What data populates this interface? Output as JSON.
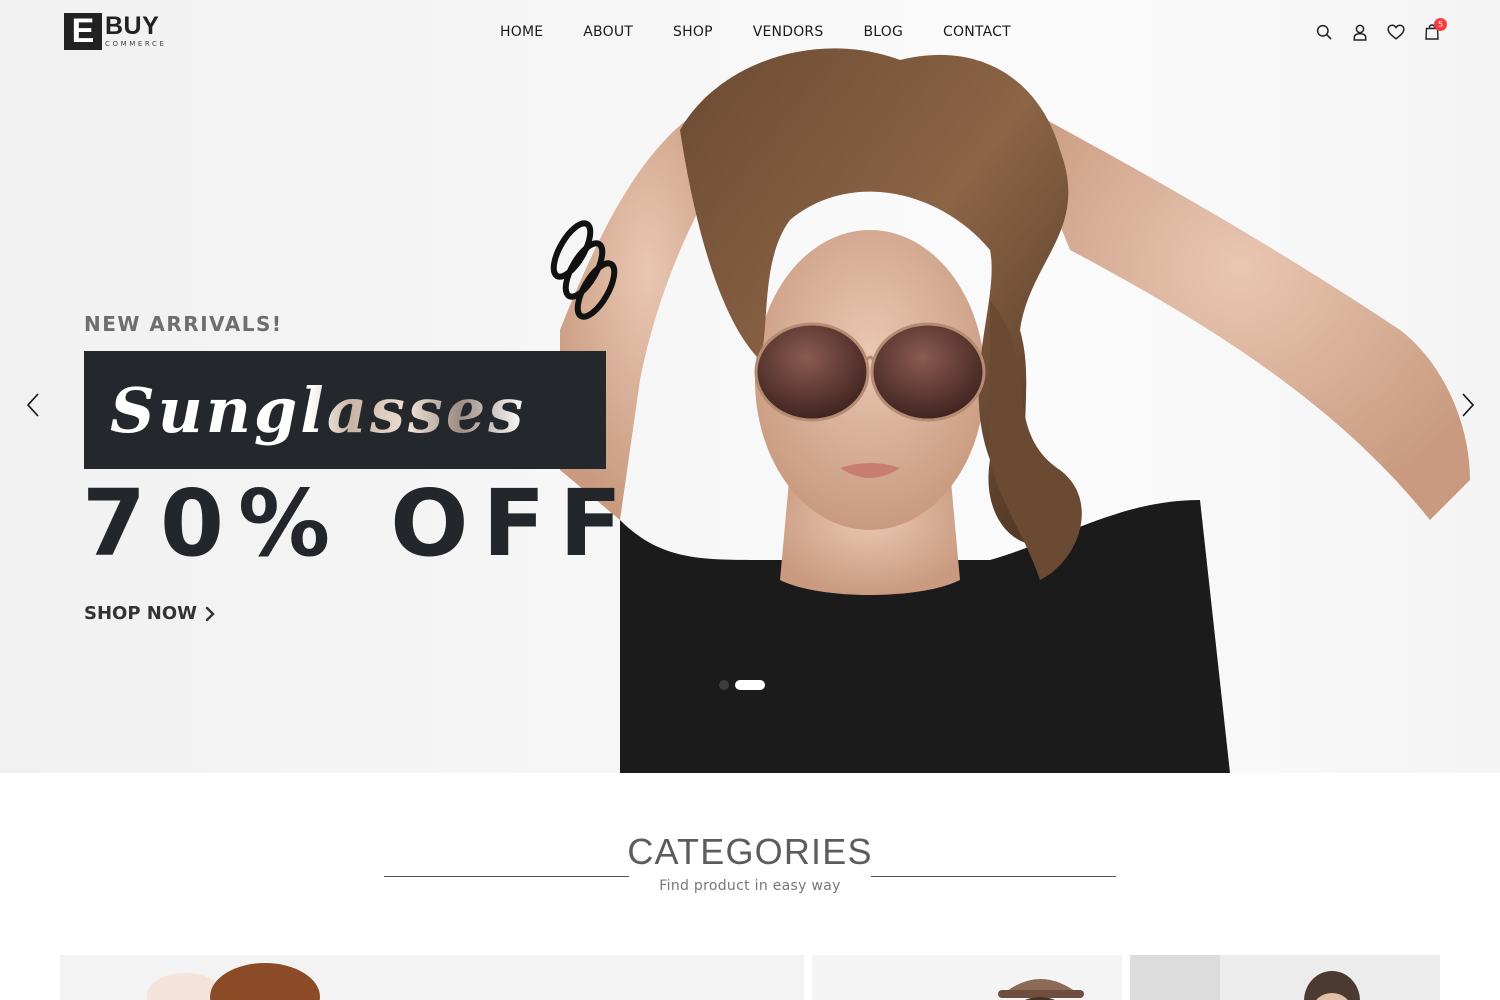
{
  "brand": {
    "mark": "E",
    "name": "BUY",
    "tagline": "COMMERCE"
  },
  "nav": {
    "items": [
      "HOME",
      "ABOUT",
      "SHOP",
      "VENDORS",
      "BLOG",
      "CONTACT"
    ]
  },
  "header_icons": {
    "search": "search-icon",
    "account": "user-icon",
    "wishlist": "heart-icon",
    "cart": "shopping-bag-icon",
    "cart_count": "5"
  },
  "hero": {
    "eyebrow": "NEW ARRIVALS!",
    "title": "Sunglasses",
    "discount": "70% OFF",
    "cta": "SHOP NOW",
    "slides": 3,
    "active_slide": 2
  },
  "categories": {
    "title": "CATEGORIES",
    "subtitle": "Find product in easy way"
  },
  "colors": {
    "badge": "#ff3a3a",
    "title_box": "#24272c",
    "text_dark": "#23262a"
  }
}
